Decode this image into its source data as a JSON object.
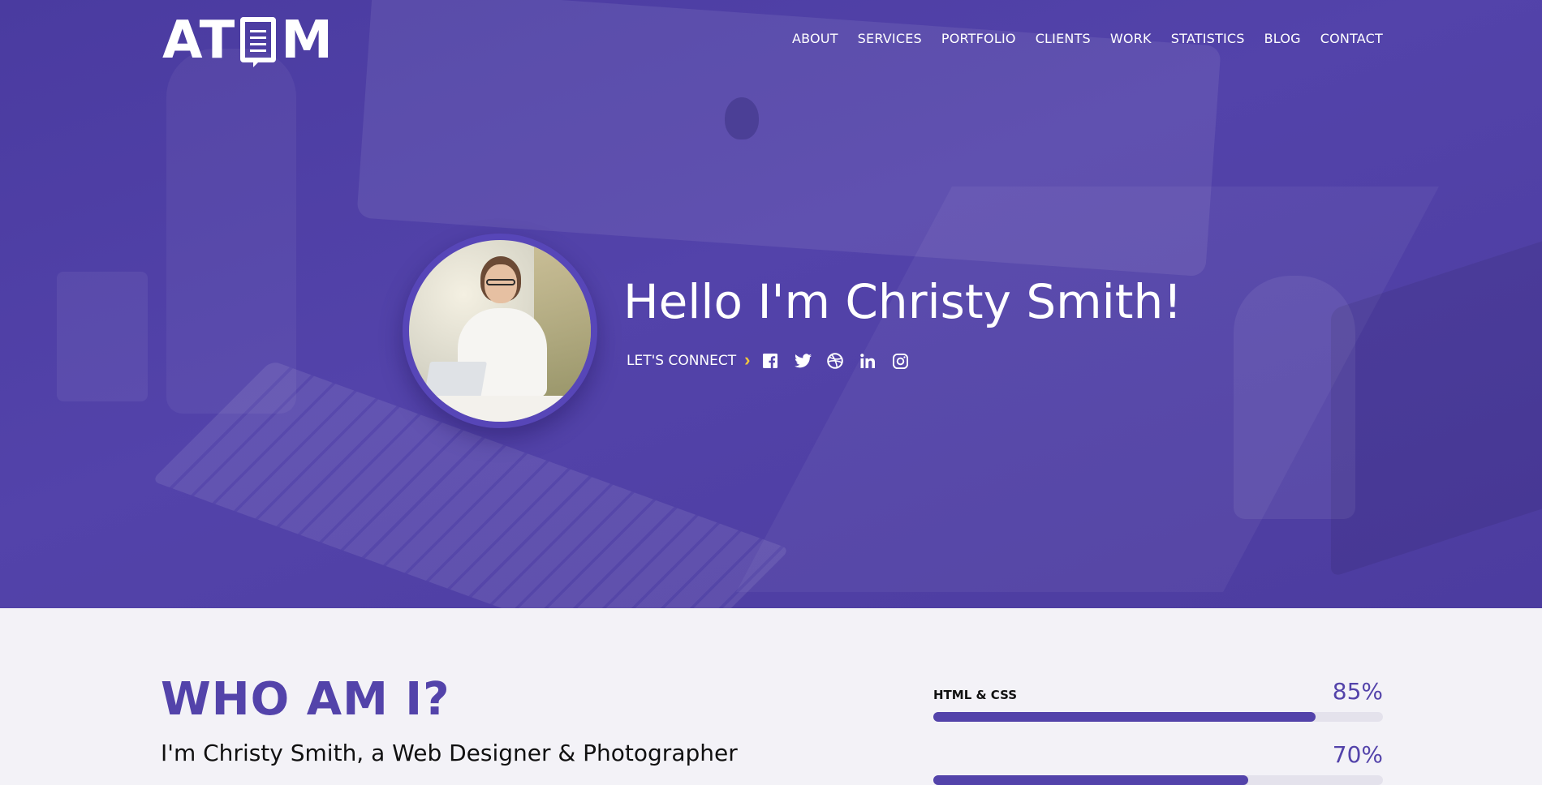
{
  "brand": {
    "logo_text_left": "AT",
    "logo_text_right": "M"
  },
  "nav": {
    "items": [
      "ABOUT",
      "SERVICES",
      "PORTFOLIO",
      "CLIENTS",
      "WORK",
      "STATISTICS",
      "BLOG",
      "CONTACT"
    ]
  },
  "hero": {
    "headline": "Hello I'm Christy Smith!",
    "connect_label": "LET'S CONNECT",
    "social_icons": [
      "facebook-icon",
      "twitter-icon",
      "dribbble-icon",
      "linkedin-icon",
      "instagram-icon"
    ]
  },
  "about": {
    "title": "WHO AM I?",
    "intro": "I'm Christy Smith, a Web Designer & Photographer"
  },
  "skills": [
    {
      "name": "HTML & CSS",
      "percent_label": "85%",
      "value": 85
    },
    {
      "name": "",
      "percent_label": "70%",
      "value": 70
    }
  ],
  "colors": {
    "accent": "#5343aa",
    "chevron": "#f3c83b",
    "hero_overlay": "#4a3ba0",
    "section_bg": "#f3f2f7"
  }
}
